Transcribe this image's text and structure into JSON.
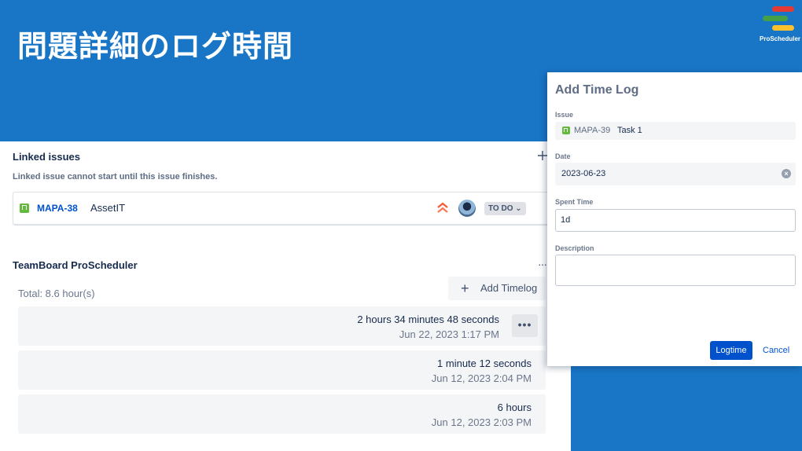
{
  "slide": {
    "title": "問題詳細のログ時間",
    "logo_text": "ProScheduler",
    "logo_colors": [
      "#e53935",
      "#43a047",
      "#fbc02d"
    ],
    "background_color": "#1976c6"
  },
  "linked_issues": {
    "title": "Linked issues",
    "add_icon": "plus-icon",
    "note": "Linked issue cannot start until this issue finishes.",
    "item": {
      "type_icon": "story-icon",
      "key": "MAPA-38",
      "summary": "AssetIT",
      "priority_icon": "highest-priority-icon",
      "status": "TO DO",
      "status_chevron": "⌄"
    }
  },
  "timesheet": {
    "title": "TeamBoard ProScheduler",
    "more_icon": "···",
    "total": "Total: 8.6 hour(s)",
    "add_button_icon": "+",
    "add_button": "Add Timelog",
    "entry_menu_icon": "•••",
    "entries": [
      {
        "duration": "2 hours 34 minutes 48 seconds",
        "date": "Jun 22, 2023 1:17 PM"
      },
      {
        "duration": "1 minute 12 seconds",
        "date": "Jun 12, 2023 2:04 PM"
      },
      {
        "duration": "6 hours",
        "date": "Jun 12, 2023 2:03 PM"
      }
    ]
  },
  "modal": {
    "title": "Add Time Log",
    "issue_label": "Issue",
    "issue_key": "MAPA-39",
    "issue_summary": "Task 1",
    "date_label": "Date",
    "date_value": "2023-06-23",
    "clear_icon": "×",
    "spent_label": "Spent Time",
    "spent_value": "1d",
    "description_label": "Description",
    "description_value": "",
    "submit": "Logtime",
    "cancel": "Cancel",
    "primary_color": "#0052cc"
  }
}
